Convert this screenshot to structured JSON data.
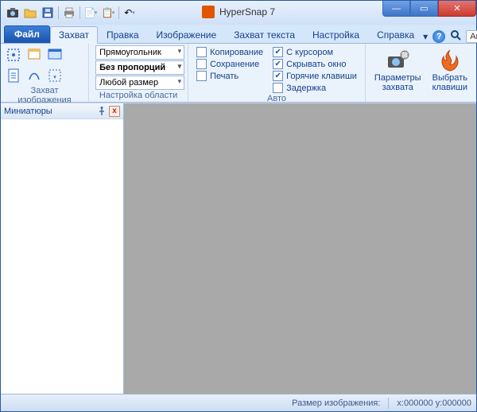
{
  "title": "HyperSnap 7",
  "window_controls": {
    "min": "—",
    "max": "▭",
    "close": "✕"
  },
  "qat": {
    "icons": [
      "camera-icon",
      "open-icon",
      "save-icon",
      "print-icon",
      "copy-icon",
      "paste-icon",
      "undo-icon"
    ]
  },
  "tabs": {
    "file": "Файл",
    "items": [
      "Захват",
      "Правка",
      "Изображение",
      "Захват текста",
      "Настройка",
      "Справка"
    ],
    "active_index": 0
  },
  "tabs_right": {
    "chevron": "▾",
    "help": "?",
    "search": "🔍",
    "auto": "Авто"
  },
  "ribbon": {
    "group1": {
      "label": "Захват изображения"
    },
    "group2": {
      "label": "Настройка области",
      "combo1": "Прямоугольник",
      "combo2": "Без пропорций",
      "combo3": "Любой размер"
    },
    "group3": {
      "label": "Авто",
      "col1": [
        {
          "label": "Копирование",
          "checked": false
        },
        {
          "label": "Сохранение",
          "checked": false
        },
        {
          "label": "Печать",
          "checked": false
        }
      ],
      "col2": [
        {
          "label": "С курсором",
          "checked": true
        },
        {
          "label": "Скрывать окно",
          "checked": true
        },
        {
          "label": "Горячие клавиши",
          "checked": true
        },
        {
          "label": "Задержка",
          "checked": false
        }
      ]
    },
    "group4": {
      "btn1_l1": "Параметры",
      "btn1_l2": "захвата",
      "btn2_l1": "Выбрать",
      "btn2_l2": "клавиши"
    }
  },
  "side": {
    "title": "Миниатюры",
    "pin": "📌",
    "close": "x"
  },
  "status": {
    "size_label": "Размер изображения:",
    "coords": "x:000000  y:000000"
  }
}
